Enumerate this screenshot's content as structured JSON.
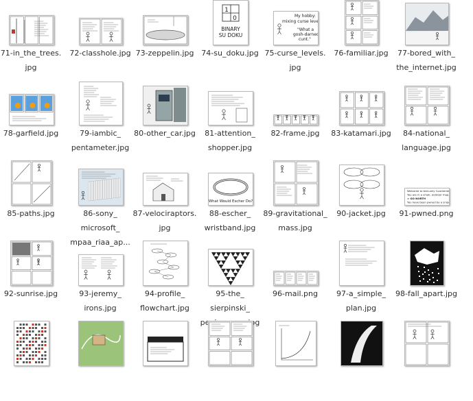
{
  "files": [
    {
      "id": 71,
      "lines": [
        "71-in_the_trees.",
        "jpg"
      ],
      "icon": "comic-thumbnail-trees-icon"
    },
    {
      "id": 72,
      "lines": [
        "72-classhole.jpg"
      ],
      "icon": "comic-thumbnail-classhole-icon"
    },
    {
      "id": 73,
      "lines": [
        "73-zeppelin.jpg"
      ],
      "icon": "comic-thumbnail-zeppelin-icon"
    },
    {
      "id": 74,
      "lines": [
        "74-su_doku.jpg"
      ],
      "icon": "comic-thumbnail-su-doku-icon",
      "thumb_text": [
        "BINARY",
        "SU DOKU"
      ],
      "digits": [
        "1",
        "0"
      ]
    },
    {
      "id": 75,
      "lines": [
        "75-curse_levels.",
        "jpg"
      ],
      "icon": "comic-thumbnail-curse-levels-icon",
      "thumb_text": [
        "My hobby:",
        "mixing curse levels",
        "\"What a",
        "gosh-darned",
        "cunt.\""
      ]
    },
    {
      "id": 76,
      "lines": [
        "76-familiar.jpg"
      ],
      "icon": "comic-thumbnail-familiar-icon"
    },
    {
      "id": 77,
      "lines": [
        "77-bored_with_",
        "the_internet.jpg"
      ],
      "icon": "comic-thumbnail-bored-internet-icon"
    },
    {
      "id": 78,
      "lines": [
        "78-garfield.jpg"
      ],
      "icon": "comic-thumbnail-garfield-icon"
    },
    {
      "id": 79,
      "lines": [
        "79-iambic_",
        "pentameter.jpg"
      ],
      "icon": "comic-thumbnail-iambic-icon"
    },
    {
      "id": 80,
      "lines": [
        "80-other_car.jpg"
      ],
      "icon": "comic-thumbnail-other-car-icon"
    },
    {
      "id": 81,
      "lines": [
        "81-attention_",
        "shopper.jpg"
      ],
      "icon": "comic-thumbnail-attention-shopper-icon"
    },
    {
      "id": 82,
      "lines": [
        "82-frame.jpg"
      ],
      "icon": "comic-thumbnail-frame-icon"
    },
    {
      "id": 83,
      "lines": [
        "83-katamari.jpg"
      ],
      "icon": "comic-thumbnail-katamari-icon"
    },
    {
      "id": 84,
      "lines": [
        "84-national_",
        "language.jpg"
      ],
      "icon": "comic-thumbnail-national-language-icon"
    },
    {
      "id": 85,
      "lines": [
        "85-paths.jpg"
      ],
      "icon": "comic-thumbnail-paths-icon"
    },
    {
      "id": 86,
      "lines": [
        "86-sony_",
        "microsoft_",
        "mpaa_riaa_ap..."
      ],
      "icon": "comic-thumbnail-sony-icon"
    },
    {
      "id": 87,
      "lines": [
        "87-velociraptors.",
        "jpg"
      ],
      "icon": "comic-thumbnail-velociraptors-icon"
    },
    {
      "id": 88,
      "lines": [
        "88-escher_",
        "wristband.jpg"
      ],
      "icon": "comic-thumbnail-escher-wristband-icon",
      "thumb_text": [
        "What Would Escher Do?"
      ]
    },
    {
      "id": 89,
      "lines": [
        "89-gravitational_",
        "mass.jpg"
      ],
      "icon": "comic-thumbnail-gravitational-mass-icon"
    },
    {
      "id": 90,
      "lines": [
        "90-jacket.jpg"
      ],
      "icon": "comic-thumbnail-jacket-icon"
    },
    {
      "id": 91,
      "lines": [
        "91-pwned.png"
      ],
      "icon": "comic-thumbnail-pwned-icon",
      "thumb_text": [
        "Welcome to text-only Counterstrike.",
        "You are in a small, outdoor map.",
        "> GO NORTH",
        "You have been pwned by a sniper."
      ]
    },
    {
      "id": 92,
      "lines": [
        "92-sunrise.jpg"
      ],
      "icon": "comic-thumbnail-sunrise-icon"
    },
    {
      "id": 93,
      "lines": [
        "93-jeremy_",
        "irons.jpg"
      ],
      "icon": "comic-thumbnail-jeremy-irons-icon"
    },
    {
      "id": 94,
      "lines": [
        "94-profile_",
        "flowchart.jpg"
      ],
      "icon": "comic-thumbnail-profile-flowchart-icon"
    },
    {
      "id": 95,
      "lines": [
        "95-the_",
        "sierpinski_",
        "penis_game.jpg"
      ],
      "icon": "comic-thumbnail-sierpinski-icon"
    },
    {
      "id": 96,
      "lines": [
        "96-mail.png"
      ],
      "icon": "comic-thumbnail-mail-icon"
    },
    {
      "id": 97,
      "lines": [
        "97-a_simple_",
        "plan.jpg"
      ],
      "icon": "comic-thumbnail-simple-plan-icon"
    },
    {
      "id": 98,
      "lines": [
        "98-fall_apart.jpg"
      ],
      "icon": "comic-thumbnail-fall-apart-icon"
    },
    {
      "id": 99,
      "lines": [],
      "icon": "comic-thumbnail-grid-icon"
    },
    {
      "id": 100,
      "lines": [],
      "icon": "comic-thumbnail-map-icon"
    },
    {
      "id": 101,
      "lines": [],
      "icon": "comic-thumbnail-box-icon"
    },
    {
      "id": 102,
      "lines": [],
      "icon": "comic-thumbnail-text-panels-icon"
    },
    {
      "id": 103,
      "lines": [],
      "icon": "comic-thumbnail-graph-icon"
    },
    {
      "id": 104,
      "lines": [],
      "icon": "comic-thumbnail-dark-icon"
    },
    {
      "id": 105,
      "lines": [],
      "icon": "comic-thumbnail-sketch-icon"
    }
  ]
}
